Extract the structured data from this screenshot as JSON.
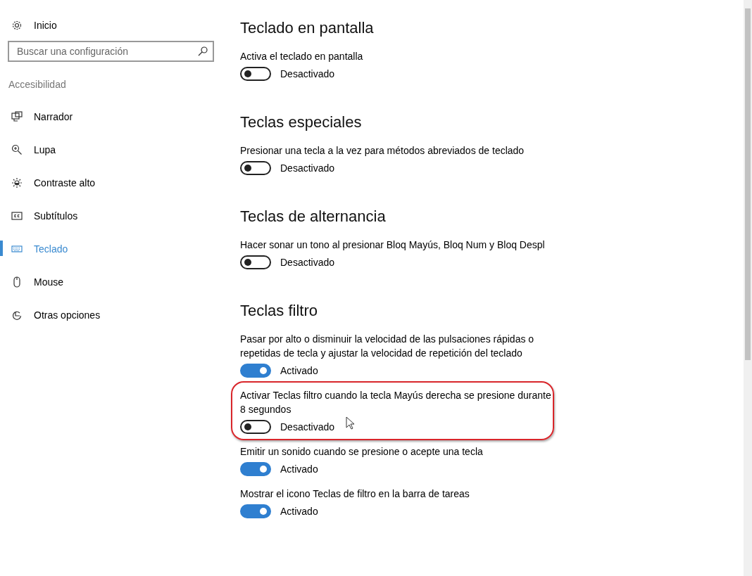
{
  "sidebar": {
    "home": "Inicio",
    "search": {
      "placeholder": "Buscar una configuración"
    },
    "group": "Accesibilidad",
    "items": [
      {
        "label": "Narrador",
        "selected": false
      },
      {
        "label": "Lupa",
        "selected": false
      },
      {
        "label": "Contraste alto",
        "selected": false
      },
      {
        "label": "Subtítulos",
        "selected": false
      },
      {
        "label": "Teclado",
        "selected": true
      },
      {
        "label": "Mouse",
        "selected": false
      },
      {
        "label": "Otras opciones",
        "selected": false
      }
    ]
  },
  "sections": [
    {
      "title": "Teclado en pantalla",
      "items": [
        {
          "description": "Activa el teclado en pantalla",
          "on": false,
          "state_label": "Desactivado",
          "highlighted": false
        }
      ]
    },
    {
      "title": "Teclas especiales",
      "items": [
        {
          "description": "Presionar una tecla a la vez para métodos abreviados de teclado",
          "on": false,
          "state_label": "Desactivado",
          "highlighted": false
        }
      ]
    },
    {
      "title": "Teclas de alternancia",
      "items": [
        {
          "description": "Hacer sonar un tono al presionar Bloq Mayús, Bloq Num y Bloq Despl",
          "on": false,
          "state_label": "Desactivado",
          "highlighted": false
        }
      ]
    },
    {
      "title": "Teclas filtro",
      "items": [
        {
          "description": "Pasar por alto o disminuir la velocidad de las pulsaciones rápidas o repetidas de tecla y ajustar la velocidad de repetición del teclado",
          "on": true,
          "state_label": "Activado",
          "highlighted": false
        },
        {
          "description": "Activar Teclas filtro cuando la tecla Mayús derecha se presione durante 8 segundos",
          "on": false,
          "state_label": "Desactivado",
          "highlighted": true
        },
        {
          "description": "Emitir un sonido cuando se presione o acepte una tecla",
          "on": true,
          "state_label": "Activado",
          "highlighted": false
        },
        {
          "description": "Mostrar el icono Teclas de filtro en la barra de tareas",
          "on": true,
          "state_label": "Activado",
          "highlighted": false
        }
      ]
    }
  ]
}
